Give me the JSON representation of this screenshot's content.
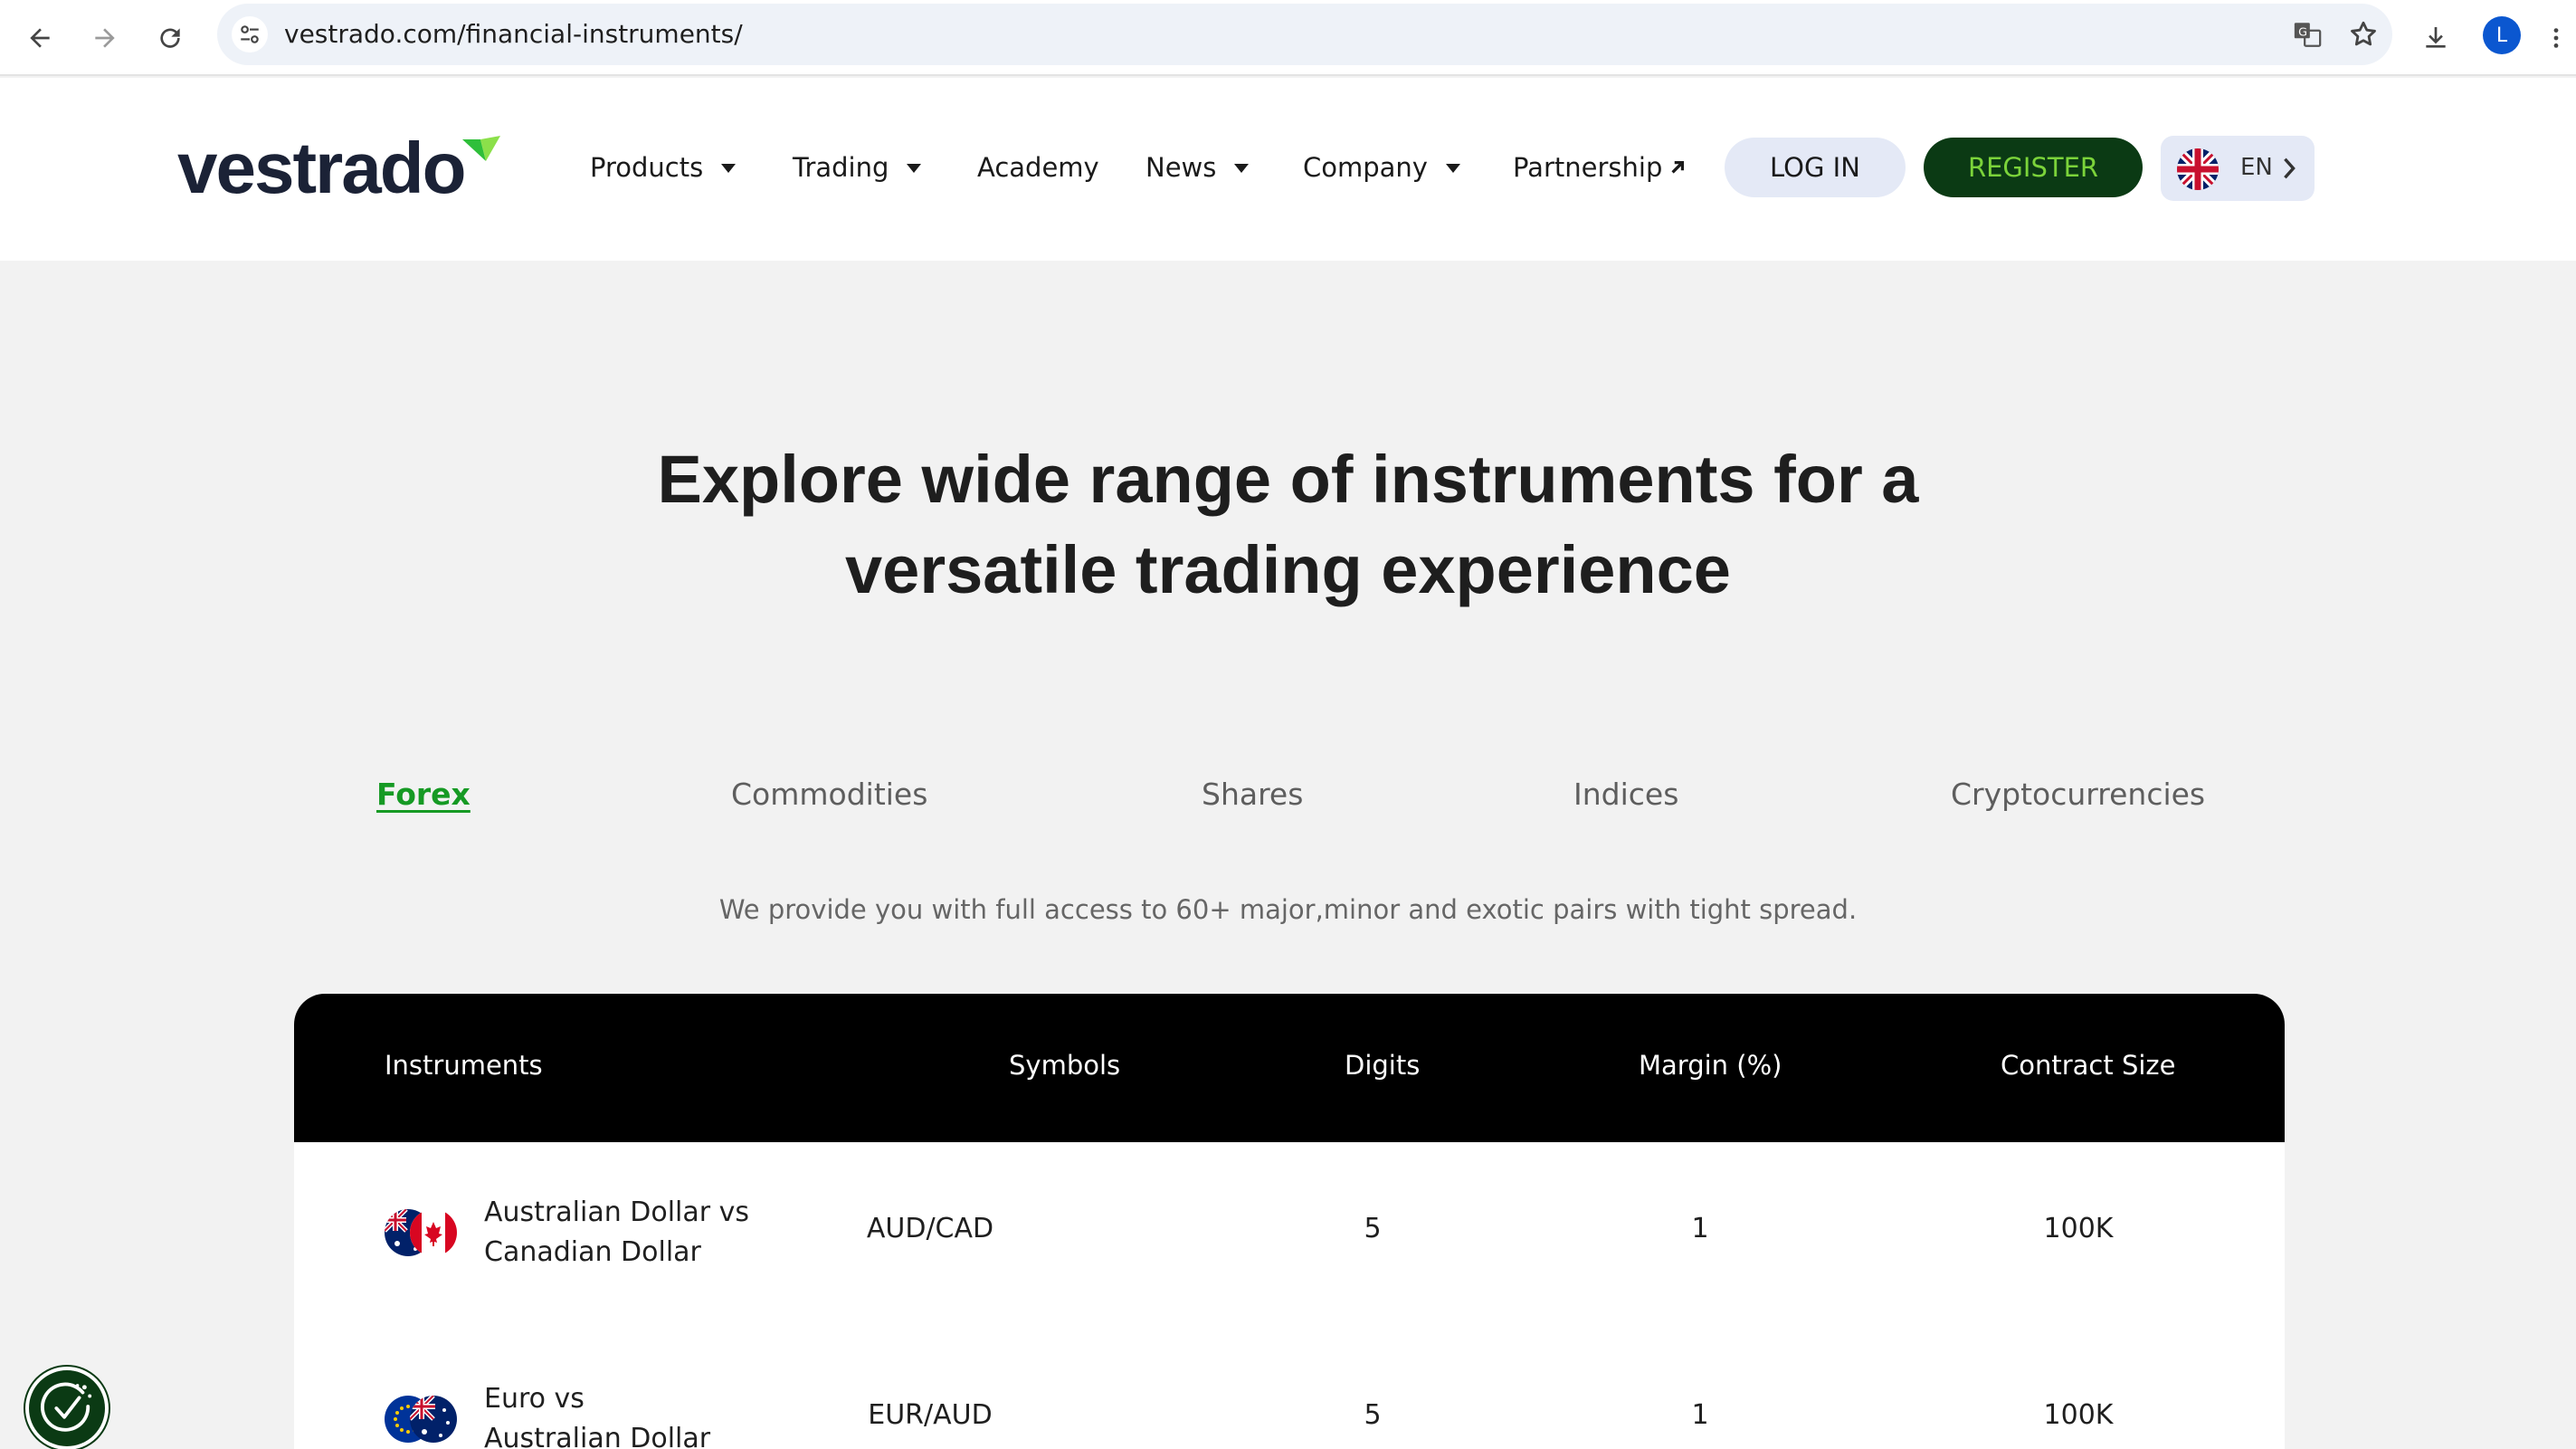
{
  "browser": {
    "url": "vestrado.com/financial-instruments/",
    "avatar_letter": "L"
  },
  "header": {
    "logo_text": "vestrado",
    "nav": [
      {
        "label": "Products",
        "has_caret": true
      },
      {
        "label": "Trading",
        "has_caret": true
      },
      {
        "label": "Academy",
        "has_caret": false
      },
      {
        "label": "News",
        "has_caret": true
      },
      {
        "label": "Company",
        "has_caret": true
      },
      {
        "label": "Partnership",
        "has_caret": false
      }
    ],
    "login_label": "LOG IN",
    "register_label": "REGISTER",
    "language_code": "EN"
  },
  "hero": {
    "title_line1": "Explore wide range of instruments for a",
    "title_line2": "versatile trading experience"
  },
  "tabs": {
    "items": [
      {
        "label": "Forex",
        "active": true
      },
      {
        "label": "Commodities",
        "active": false
      },
      {
        "label": "Shares",
        "active": false
      },
      {
        "label": "Indices",
        "active": false
      },
      {
        "label": "Cryptocurrencies",
        "active": false
      }
    ],
    "description": "We provide you with full access to 60+ major,minor and exotic pairs with tight spread."
  },
  "table": {
    "headers": {
      "instruments": "Instruments",
      "symbols": "Symbols",
      "digits": "Digits",
      "margin": "Margin (%)",
      "contract_size": "Contract Size"
    },
    "rows": [
      {
        "name_line1": "Australian Dollar vs",
        "name_line2": "Canadian Dollar",
        "symbol": "AUD/CAD",
        "digits": "5",
        "margin": "1",
        "contract_size": "100K",
        "flag_a": "au-flag-icon",
        "flag_b": "ca-flag-icon"
      },
      {
        "name_line1": "Euro vs",
        "name_line2": "Australian Dollar",
        "symbol": "EUR/AUD",
        "digits": "5",
        "margin": "1",
        "contract_size": "100K",
        "flag_a": "eu-flag-icon",
        "flag_b": "au-flag-icon"
      }
    ]
  },
  "colors": {
    "brand_dark_green": "#0b3a14",
    "brand_lime": "#7bd33a",
    "active_tab": "#169a24",
    "table_header_bg": "#000000"
  }
}
